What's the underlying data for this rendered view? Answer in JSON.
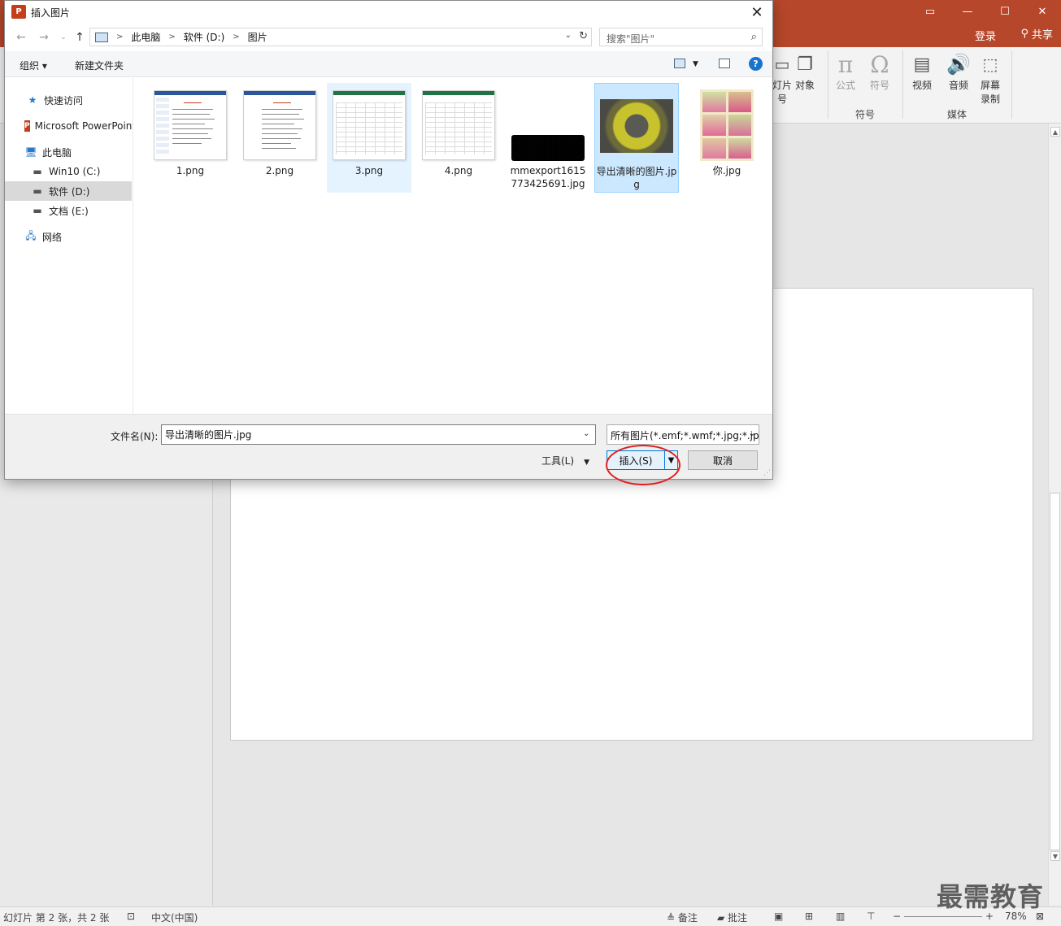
{
  "ppt": {
    "titlebar_color": "#b7472a",
    "window_controls": [
      "▭",
      "—",
      "☐",
      "✕"
    ],
    "login": "登录",
    "share": "共享",
    "ribbon": {
      "partial_left_1": "灯片",
      "partial_left_2": "号",
      "object": "对象",
      "formula": "公式",
      "symbol": "符号",
      "group_symbols": "符号",
      "video": "视频",
      "audio": "音频",
      "screen_record_1": "屏幕",
      "screen_record_2": "录制",
      "group_media": "媒体"
    },
    "status": {
      "slide_info": "幻灯片 第 2 张，共 2 张",
      "language": "中文(中国)",
      "notes": "备注",
      "comments": "批注",
      "zoom": "78%"
    },
    "watermark": "最需教育"
  },
  "dialog": {
    "title": "插入图片",
    "app_icon": "P",
    "address": {
      "crumbs": [
        "此电脑",
        "软件 (D:)",
        "图片"
      ]
    },
    "search_placeholder": "搜索\"图片\"",
    "toolbar": {
      "organize": "组织 ▾",
      "new_folder": "新建文件夹",
      "help": "?"
    },
    "nav": [
      {
        "label": "快速访问",
        "icon": "★"
      },
      {
        "label": "Microsoft PowerPoint",
        "icon": "P"
      },
      {
        "label": "此电脑",
        "icon": "🖥"
      },
      {
        "label": "Win10 (C:)",
        "icon": "▬"
      },
      {
        "label": "软件 (D:)",
        "icon": "▬"
      },
      {
        "label": "文档 (E:)",
        "icon": "▬"
      },
      {
        "label": "网络",
        "icon": "🖧"
      }
    ],
    "files": [
      {
        "name": "1.png"
      },
      {
        "name": "2.png"
      },
      {
        "name": "3.png"
      },
      {
        "name": "4.png"
      },
      {
        "name": "mmexport1615773425691.jpg"
      },
      {
        "name": "导出清晰的图片.jpg"
      },
      {
        "name": "你.jpg"
      }
    ],
    "filename_label": "文件名(N):",
    "filename_value": "导出清晰的图片.jpg",
    "filter": "所有图片(*.emf;*.wmf;*.jpg;*.jp",
    "tools": "工具(L)",
    "insert": "插入(S)",
    "cancel": "取消"
  },
  "colors": {
    "accent": "#0078d7",
    "highlight": "#e02020",
    "selection": "#cce8ff"
  }
}
